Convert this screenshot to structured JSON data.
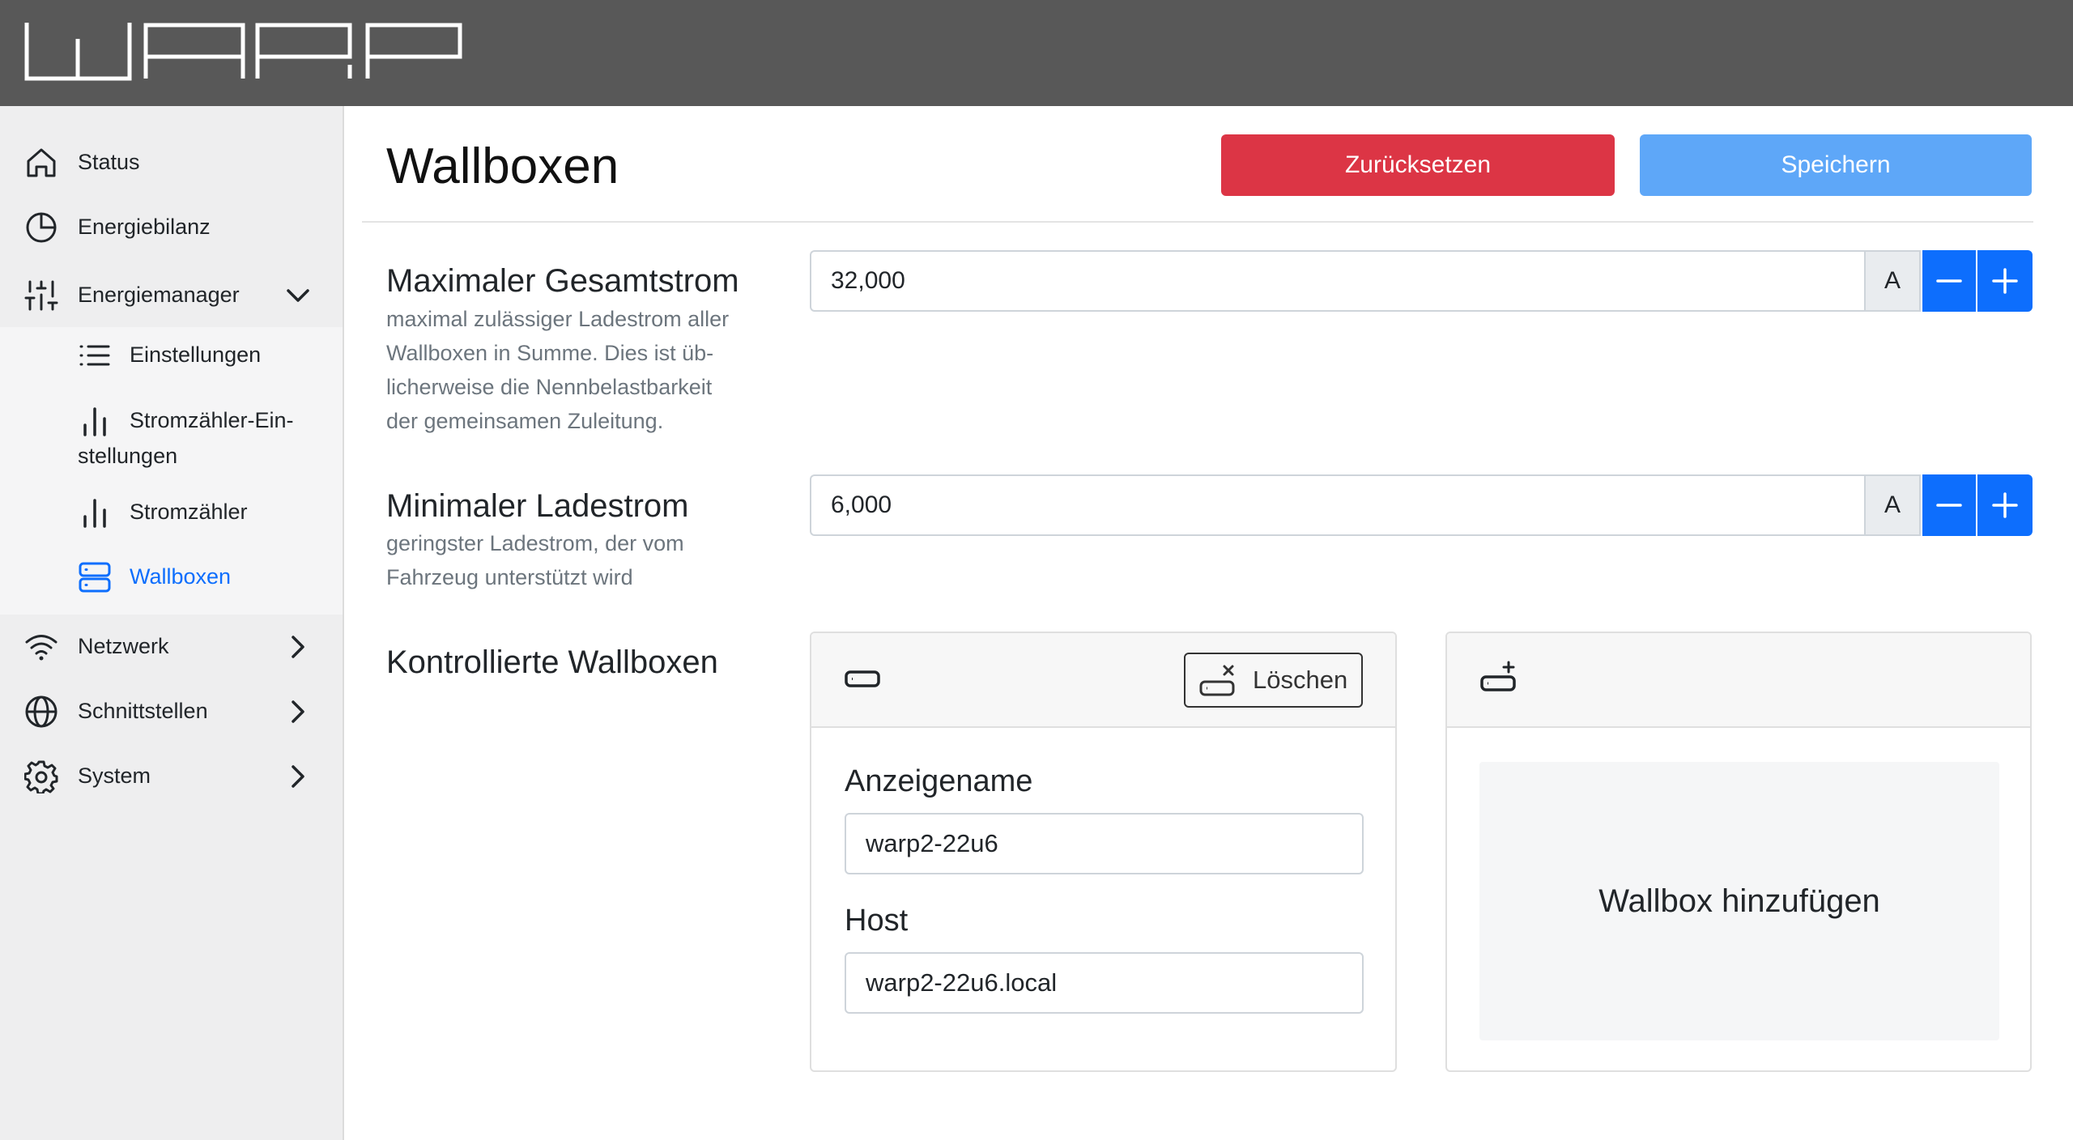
{
  "brand": {
    "logo_text": "WARP"
  },
  "sidebar": {
    "items": [
      {
        "label": "Status",
        "icon": "home-icon"
      },
      {
        "label": "Energiebilanz",
        "icon": "pie-chart-icon"
      },
      {
        "label": "Energiemanager",
        "icon": "sliders-icon",
        "expanded": true,
        "children": [
          {
            "label": "Einstellungen",
            "icon": "list-icon"
          },
          {
            "label": "Stromzähler-Ein-\nstellungen",
            "icon": "bar-chart-icon"
          },
          {
            "label": "Stromzähler",
            "icon": "bar-chart-icon"
          },
          {
            "label": "Wallboxen",
            "icon": "server-icon",
            "active": true
          }
        ]
      },
      {
        "label": "Netzwerk",
        "icon": "wifi-icon"
      },
      {
        "label": "Schnittstellen",
        "icon": "globe-icon"
      },
      {
        "label": "System",
        "icon": "gear-icon"
      }
    ]
  },
  "header": {
    "title": "Wallboxen",
    "reset_label": "Zurücksetzen",
    "save_label": "Speichern"
  },
  "colors": {
    "danger": "#dc3545",
    "primary": "#0d6efd",
    "save_disabled": "#5ea7f8",
    "topbar": "#585858"
  },
  "form": {
    "max_current": {
      "label": "Maximaler Gesamtstrom",
      "help_lines": [
        "maximal zulässiger Ladestrom aller",
        "Wallboxen in Summe. Dies ist üb-",
        "licherweise die Nennbelastbarkeit",
        "der gemeinsamen Zuleitung."
      ],
      "value": "32,000",
      "unit": "A"
    },
    "min_current": {
      "label": "Minimaler Ladestrom",
      "help_lines": [
        "geringster Ladestrom, der vom",
        "Fahrzeug unterstützt wird"
      ],
      "value": "6,000",
      "unit": "A"
    },
    "controlled": {
      "label": "Kontrollierte Wallboxen",
      "cards": [
        {
          "delete_label": "Löschen",
          "name_label": "Anzeigename",
          "name_value": "warp2-22u6",
          "host_label": "Host",
          "host_value": "warp2-22u6.local"
        }
      ],
      "add_label": "Wallbox hinzufügen"
    }
  }
}
